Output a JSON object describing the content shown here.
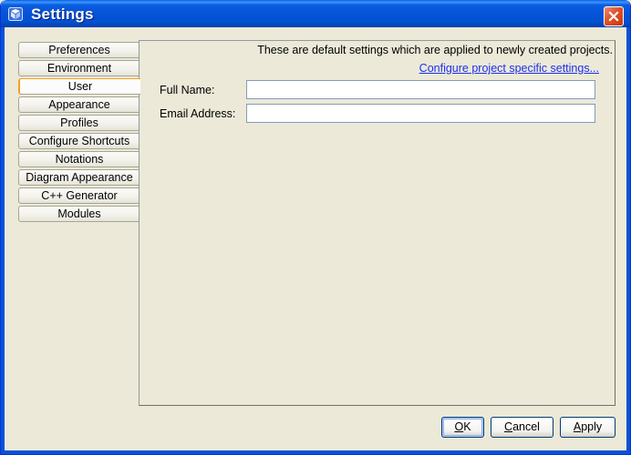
{
  "window": {
    "title": "Settings",
    "icon": "app-cube-icon",
    "close_icon": "close-icon"
  },
  "tabs": [
    {
      "label": "Preferences",
      "active": false
    },
    {
      "label": "Environment",
      "active": false
    },
    {
      "label": "User",
      "active": true
    },
    {
      "label": "Appearance",
      "active": false
    },
    {
      "label": "Profiles",
      "active": false
    },
    {
      "label": "Configure Shortcuts",
      "active": false
    },
    {
      "label": "Notations",
      "active": false
    },
    {
      "label": "Diagram Appearance",
      "active": false
    },
    {
      "label": "C++ Generator",
      "active": false
    },
    {
      "label": "Modules",
      "active": false
    }
  ],
  "panel": {
    "description": "These are default settings which are applied to newly created projects.",
    "link": "Configure project specific settings...",
    "fields": [
      {
        "label": "Full Name:",
        "value": ""
      },
      {
        "label": "Email Address:",
        "value": ""
      }
    ]
  },
  "buttons": {
    "ok": {
      "mnemonic": "O",
      "rest": "K"
    },
    "cancel": {
      "mnemonic": "C",
      "rest": "ancel"
    },
    "apply": {
      "mnemonic": "A",
      "rest": "pply"
    }
  },
  "colors": {
    "titlebar": "#0553d6",
    "active_tab_accent": "#f5a022",
    "link": "#1a30f0",
    "dialog_bg": "#ece9d8"
  }
}
